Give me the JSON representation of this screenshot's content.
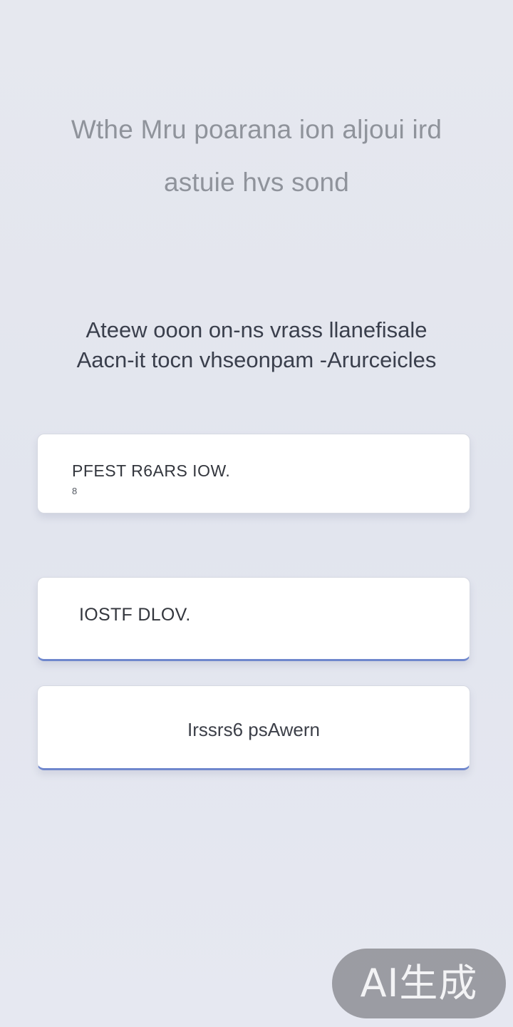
{
  "header": {
    "title_line1": "Wthe Mru poarana ion aljoui ird",
    "title_line2": "astuie hvs sond"
  },
  "subheading": {
    "line1": "Ateew ooon on-ns vrass llanefisale",
    "line2": "Aacn-it tocn vhseonpam -Arurceicles"
  },
  "cards": {
    "primary": {
      "label": "PFEST R6ARS IOW.",
      "sublabel": "8"
    },
    "secondary": {
      "label": "IOSTF DLOV."
    },
    "third": {
      "label": "Irssrs6 psAwern"
    }
  },
  "watermark": {
    "text": "AI生成"
  }
}
